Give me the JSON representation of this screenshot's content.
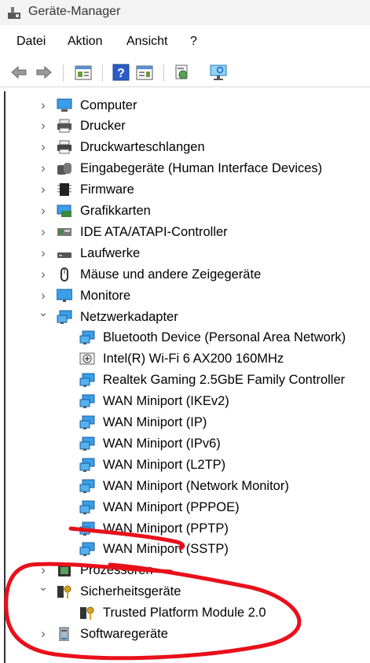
{
  "window": {
    "title": "Geräte-Manager"
  },
  "menu": {
    "items": [
      "Datei",
      "Aktion",
      "Ansicht",
      "?"
    ]
  },
  "toolbar": {
    "buttons": [
      "back-icon",
      "forward-icon",
      "properties-icon",
      "help-icon",
      "view-icon",
      "scan-hardware-icon",
      "monitor-icon"
    ]
  },
  "tree": {
    "categories": [
      {
        "label": "Computer",
        "icon": "computer-icon",
        "expanded": false
      },
      {
        "label": "Drucker",
        "icon": "printer-icon",
        "expanded": false
      },
      {
        "label": "Druckwarteschlangen",
        "icon": "print-queue-icon",
        "expanded": false
      },
      {
        "label": "Eingabegeräte (Human Interface Devices)",
        "icon": "hid-icon",
        "expanded": false
      },
      {
        "label": "Firmware",
        "icon": "firmware-icon",
        "expanded": false
      },
      {
        "label": "Grafikkarten",
        "icon": "display-adapter-icon",
        "expanded": false
      },
      {
        "label": "IDE ATA/ATAPI-Controller",
        "icon": "ide-controller-icon",
        "expanded": false
      },
      {
        "label": "Laufwerke",
        "icon": "drive-icon",
        "expanded": false
      },
      {
        "label": "Mäuse und andere Zeigegeräte",
        "icon": "mouse-icon",
        "expanded": false
      },
      {
        "label": "Monitore",
        "icon": "monitor-icon",
        "expanded": false
      },
      {
        "label": "Netzwerkadapter",
        "icon": "network-adapter-icon",
        "expanded": true,
        "children": [
          "Bluetooth Device (Personal Area Network)",
          "Intel(R) Wi-Fi 6 AX200 160MHz",
          "Realtek Gaming 2.5GbE Family Controller",
          "WAN Miniport (IKEv2)",
          "WAN Miniport (IP)",
          "WAN Miniport (IPv6)",
          "WAN Miniport (L2TP)",
          "WAN Miniport (Network Monitor)",
          "WAN Miniport (PPPOE)",
          "WAN Miniport (PPTP)",
          "WAN Miniport (SSTP)"
        ]
      },
      {
        "label": "Prozessoren",
        "icon": "processor-icon",
        "expanded": false
      },
      {
        "label": "Sicherheitsgeräte",
        "icon": "security-device-icon",
        "expanded": true,
        "children": [
          "Trusted Platform Module 2.0"
        ]
      },
      {
        "label": "Softwaregeräte",
        "icon": "software-device-icon",
        "expanded": false
      }
    ]
  },
  "colors": {
    "annotation": "#e8101a",
    "accent": "#1e88e5"
  }
}
